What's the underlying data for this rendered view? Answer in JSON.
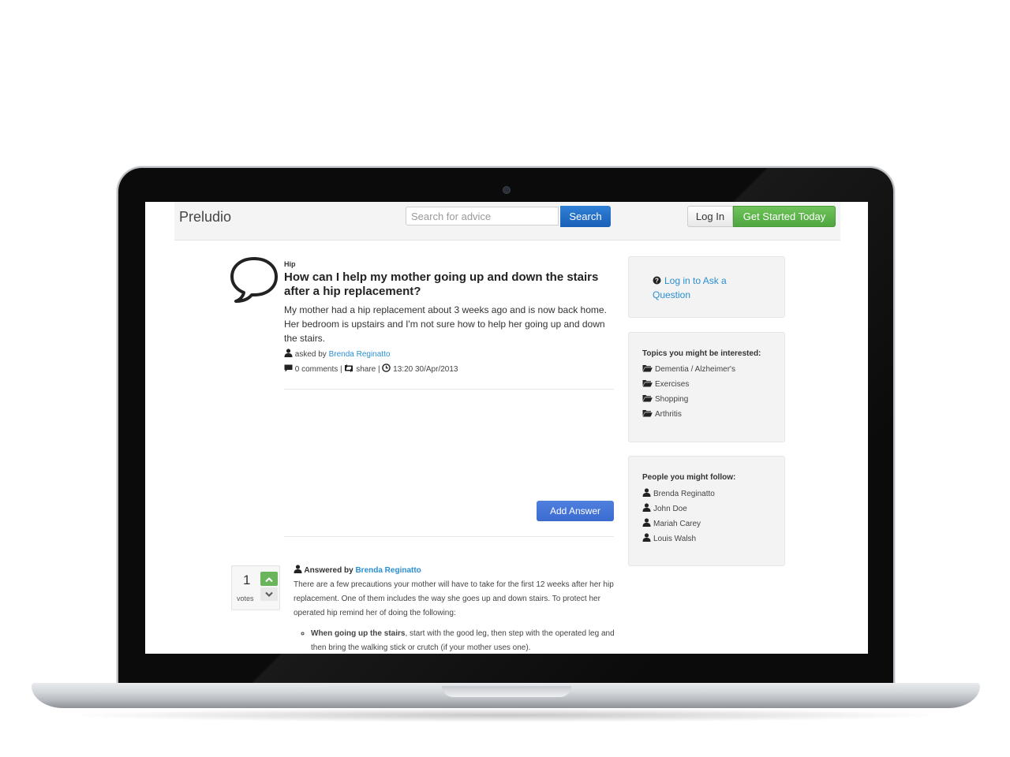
{
  "navbar": {
    "brand": "Preludio",
    "search_placeholder": "Search for advice",
    "search_label": "Search",
    "login_label": "Log In",
    "get_started_label": "Get Started Today"
  },
  "question": {
    "topic": "Hip",
    "title": "How can I help my mother going up and down the stairs after a hip replacement?",
    "body": "My mother had a hip replacement about 3 weeks ago and is now back home. Her bedroom is upstairs and I'm not sure how to help her going up and down the stairs.",
    "asked_by_prefix": "asked by",
    "asked_by_name": "Brenda Reginatto",
    "comments": "0 comments",
    "sep1": "|",
    "share": "share",
    "sep2": "|",
    "timestamp": "13:20 30/Apr/2013",
    "add_answer_label": "Add Answer"
  },
  "answer": {
    "votes": "1",
    "votes_label": "votes",
    "answered_by_prefix": "Answered by",
    "answered_by_name": "Brenda Reginatto",
    "body": "There are a few precautions your mother will have to take for the first 12 weeks after her hip replacement. One of them includes the way she goes up and down stairs. To protect her operated hip remind her of doing the following:",
    "list": [
      {
        "bold": "When going up the stairs",
        "rest": ", start with the good leg, then step with the operated leg and then bring the walking stick or crutch (if your mother uses one)."
      }
    ]
  },
  "sidebar": {
    "ask_link": "Log in to Ask a Question",
    "topics_title": "Topics you might be interested:",
    "topics": [
      "Dementia / Alzheimer's",
      "Exercises",
      "Shopping",
      "Arthritis"
    ],
    "people_title": "People you might follow:",
    "people": [
      "Brenda Reginatto",
      "John Doe",
      "Mariah Carey",
      "Louis Walsh"
    ]
  },
  "colors": {
    "accent_blue": "#2a8fd1",
    "search_button": "#1b5fb8",
    "cta_green": "#4fa63f",
    "add_answer": "#3b6bd0",
    "vote_up": "#6ab55c"
  }
}
